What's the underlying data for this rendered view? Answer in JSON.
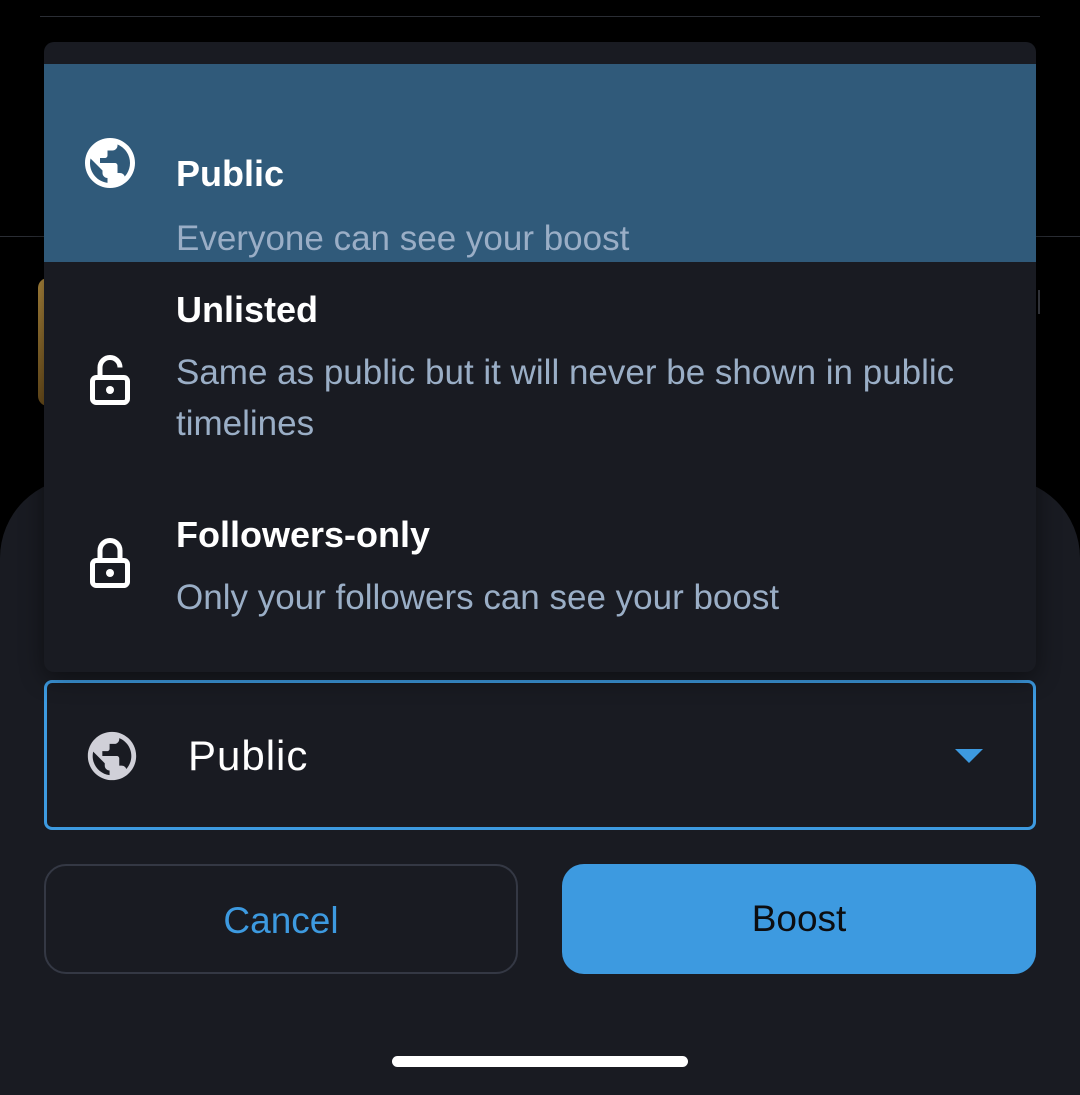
{
  "visibility_menu": {
    "items": [
      {
        "title": "Public",
        "description": "Everyone can see your boost",
        "icon": "globe-icon",
        "selected": true
      },
      {
        "title": "Unlisted",
        "description": "Same as public but it will never be shown in public timelines",
        "icon": "lock-open-icon",
        "selected": false
      },
      {
        "title": "Followers-only",
        "description": "Only your followers can see your boost",
        "icon": "lock-icon",
        "selected": false
      }
    ]
  },
  "visibility_select": {
    "value": "Public",
    "icon": "globe-icon"
  },
  "actions": {
    "cancel_label": "Cancel",
    "boost_label": "Boost"
  },
  "colors": {
    "accent": "#3d9ae0",
    "selected_item_bg": "#305a7a",
    "sheet_bg": "#191b22",
    "description_text": "#9aaec6"
  }
}
